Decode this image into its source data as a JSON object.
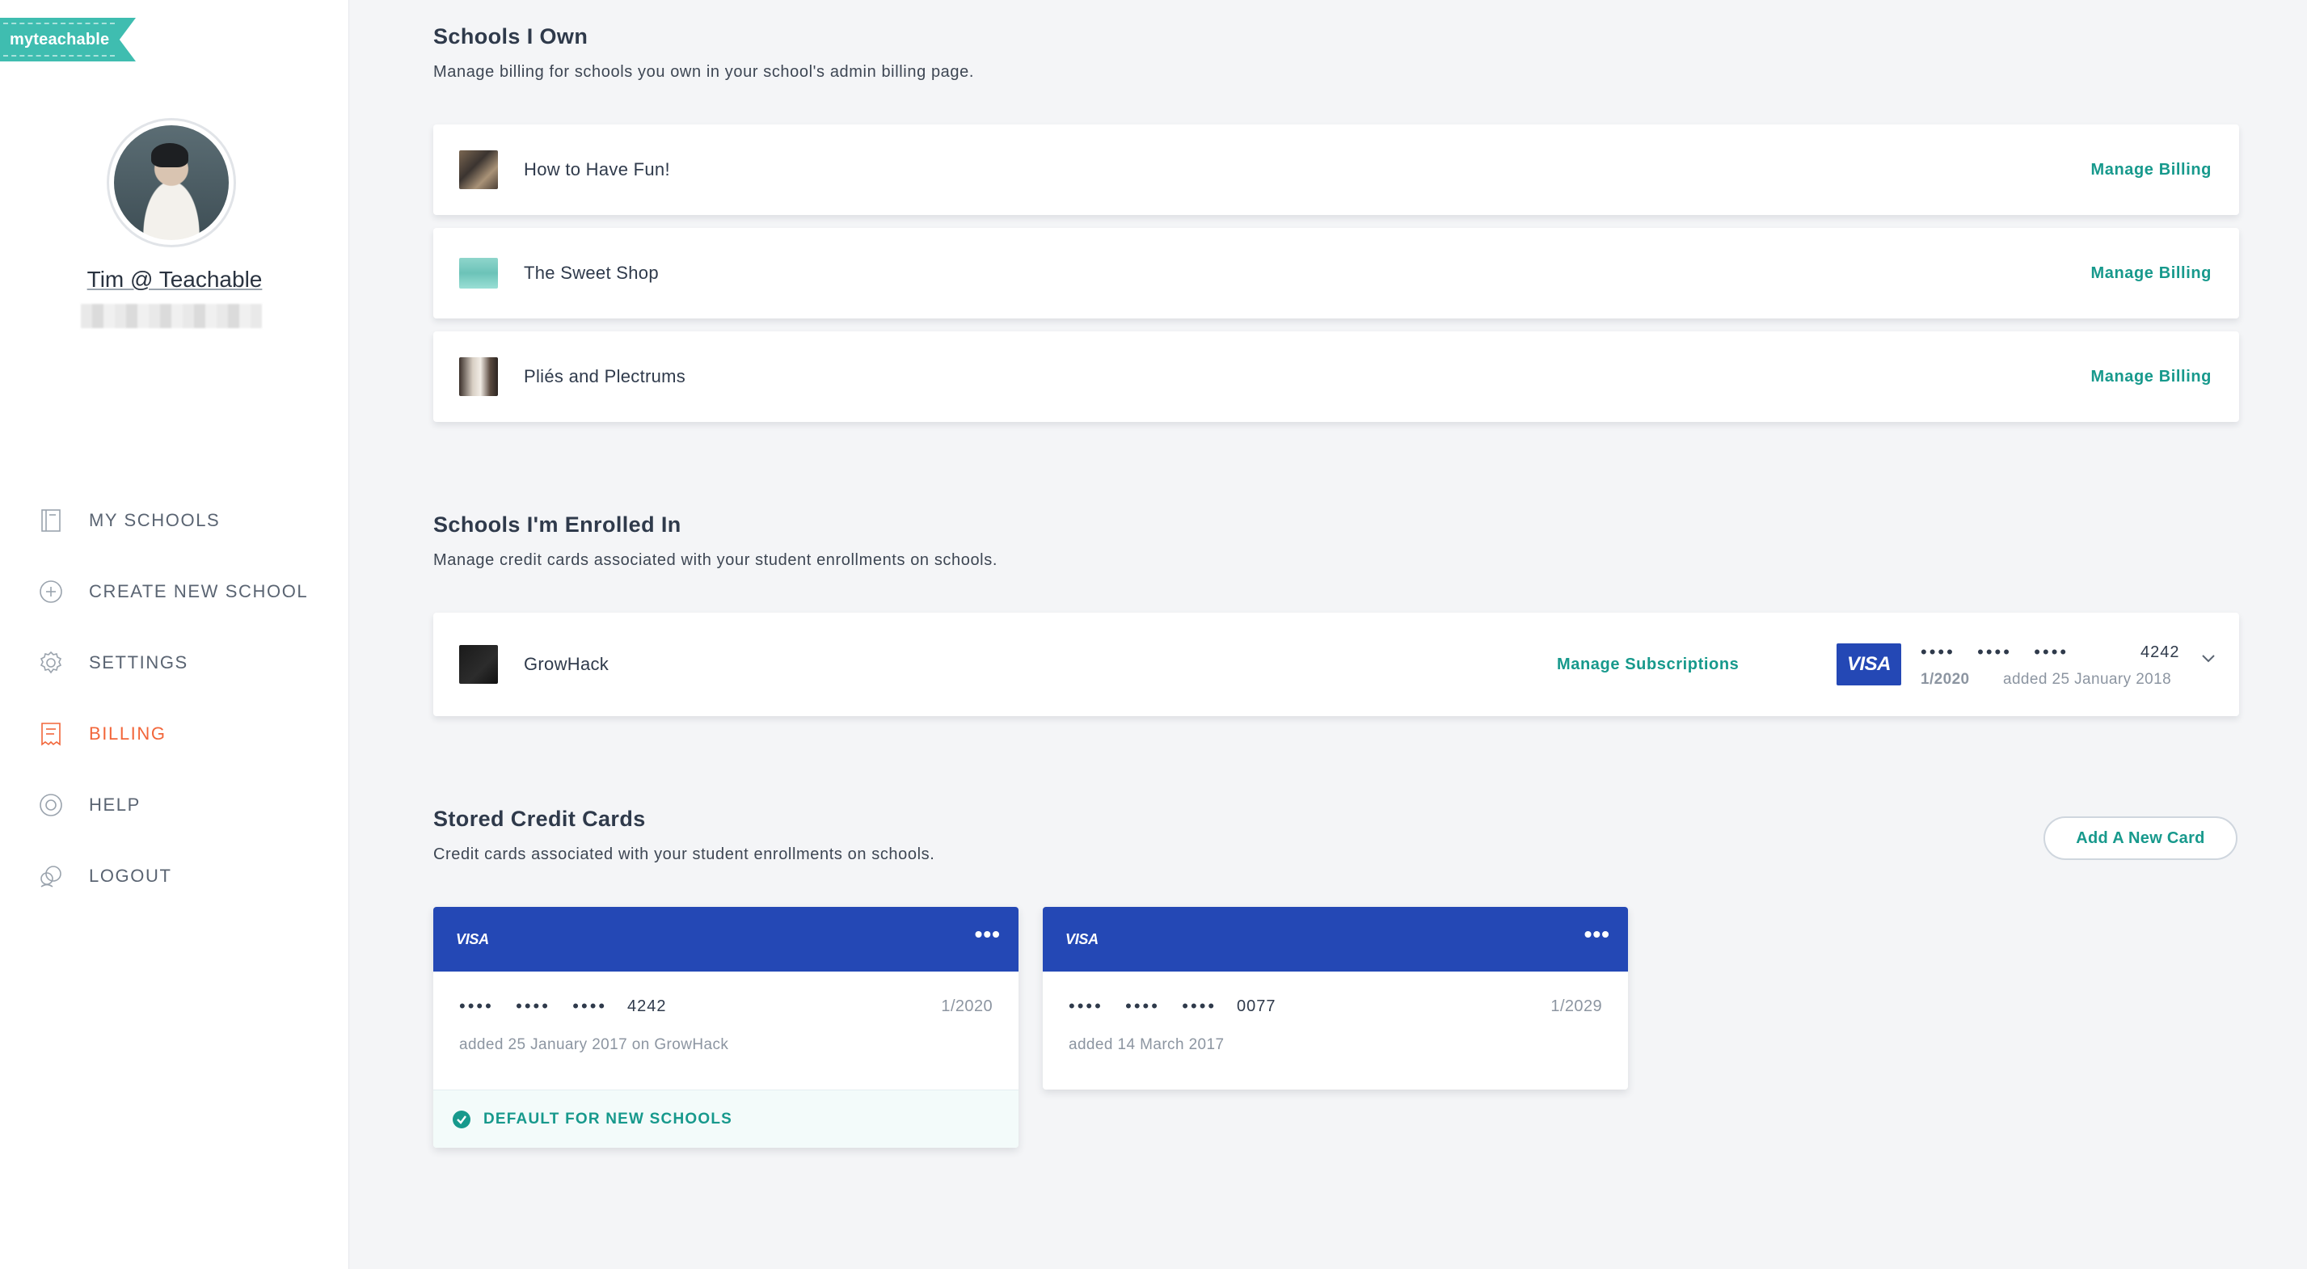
{
  "brand": {
    "logo_text": "myteachable",
    "accent": "#3fbdb0",
    "link_color": "#17998c",
    "active_nav_color": "#f2663a",
    "visa_blue": "#2448b5"
  },
  "user": {
    "name": "Tim @ Teachable"
  },
  "nav": {
    "items": [
      {
        "label": "MY SCHOOLS",
        "icon": "school-icon"
      },
      {
        "label": "CREATE NEW SCHOOL",
        "icon": "plus-circle-icon"
      },
      {
        "label": "SETTINGS",
        "icon": "gear-icon"
      },
      {
        "label": "BILLING",
        "icon": "receipt-icon",
        "active": true
      },
      {
        "label": "HELP",
        "icon": "lifebuoy-icon"
      },
      {
        "label": "LOGOUT",
        "icon": "logout-icon"
      }
    ]
  },
  "owned": {
    "title": "Schools I Own",
    "subtitle": "Manage billing for schools you own in your school's admin billing page.",
    "schools": [
      {
        "name": "How to Have Fun!",
        "action": "Manage Billing"
      },
      {
        "name": "The Sweet Shop",
        "action": "Manage Billing"
      },
      {
        "name": "Pliés and Plectrums",
        "action": "Manage Billing"
      }
    ]
  },
  "enrolled": {
    "title": "Schools I'm Enrolled In",
    "subtitle": "Manage credit cards associated with your student enrollments on schools.",
    "school": {
      "name": "GrowHack",
      "action": "Manage Subscriptions",
      "card_brand": "VISA",
      "dots": "••••   ••••   ••••",
      "last4": "4242",
      "expiry": "1/2020",
      "added": "added 25 January 2018"
    }
  },
  "stored": {
    "title": "Stored Credit Cards",
    "subtitle": "Credit cards associated with your student enrollments on schools.",
    "add_button": "Add A New Card",
    "cards": [
      {
        "brand": "VISA",
        "menu": "•••",
        "dots": "••••   ••••   ••••",
        "last4": "4242",
        "expiry": "1/2020",
        "added": "added 25 January 2017 on GrowHack",
        "default_label": "DEFAULT FOR NEW SCHOOLS"
      },
      {
        "brand": "VISA",
        "menu": "•••",
        "dots": "••••   ••••   ••••",
        "last4": "0077",
        "expiry": "1/2029",
        "added": "added 14 March 2017"
      }
    ]
  }
}
